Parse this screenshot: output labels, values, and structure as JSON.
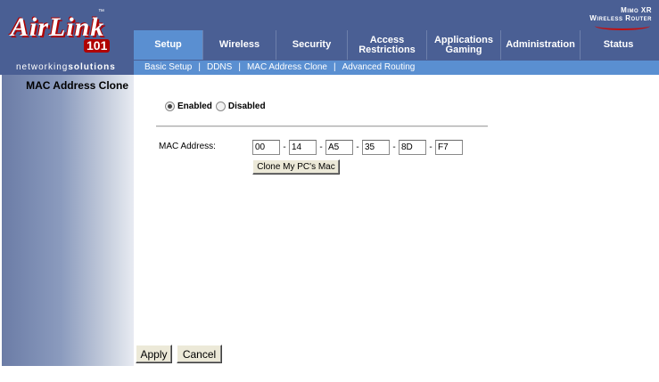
{
  "brand": {
    "logo_text": "AirLink",
    "logo_number": "101",
    "logo_tm": "™",
    "tagline_part1": "networking",
    "tagline_part2": "solutions",
    "product_line1": "Mimo XR",
    "product_line2": "Wireless Router"
  },
  "colors": {
    "header_bg": "#4a5f94",
    "active_tab_bg": "#5a8fd1",
    "logo_accent": "#b00000"
  },
  "tabs": [
    {
      "label": "Setup",
      "active": true
    },
    {
      "label": "Wireless",
      "active": false
    },
    {
      "label": "Security",
      "active": false
    },
    {
      "label": "Access\nRestrictions",
      "active": false
    },
    {
      "label": "Applications\nGaming",
      "active": false
    },
    {
      "label": "Administration",
      "active": false
    },
    {
      "label": "Status",
      "active": false
    }
  ],
  "subnav": [
    {
      "label": "Basic Setup"
    },
    {
      "label": "DDNS"
    },
    {
      "label": "MAC Address Clone"
    },
    {
      "label": "Advanced Routing"
    }
  ],
  "subnav_separator": "|",
  "sidebar": {
    "section_title": "MAC Address Clone"
  },
  "clone_mode": {
    "enabled_label": "Enabled",
    "disabled_label": "Disabled",
    "selected": "enabled"
  },
  "mac": {
    "label": "MAC Address:",
    "octets": [
      "00",
      "14",
      "A5",
      "35",
      "8D",
      "F7"
    ],
    "separator": "-",
    "clone_button_label": "Clone My PC's Mac"
  },
  "footer": {
    "apply_label": "Apply",
    "cancel_label": "Cancel"
  }
}
